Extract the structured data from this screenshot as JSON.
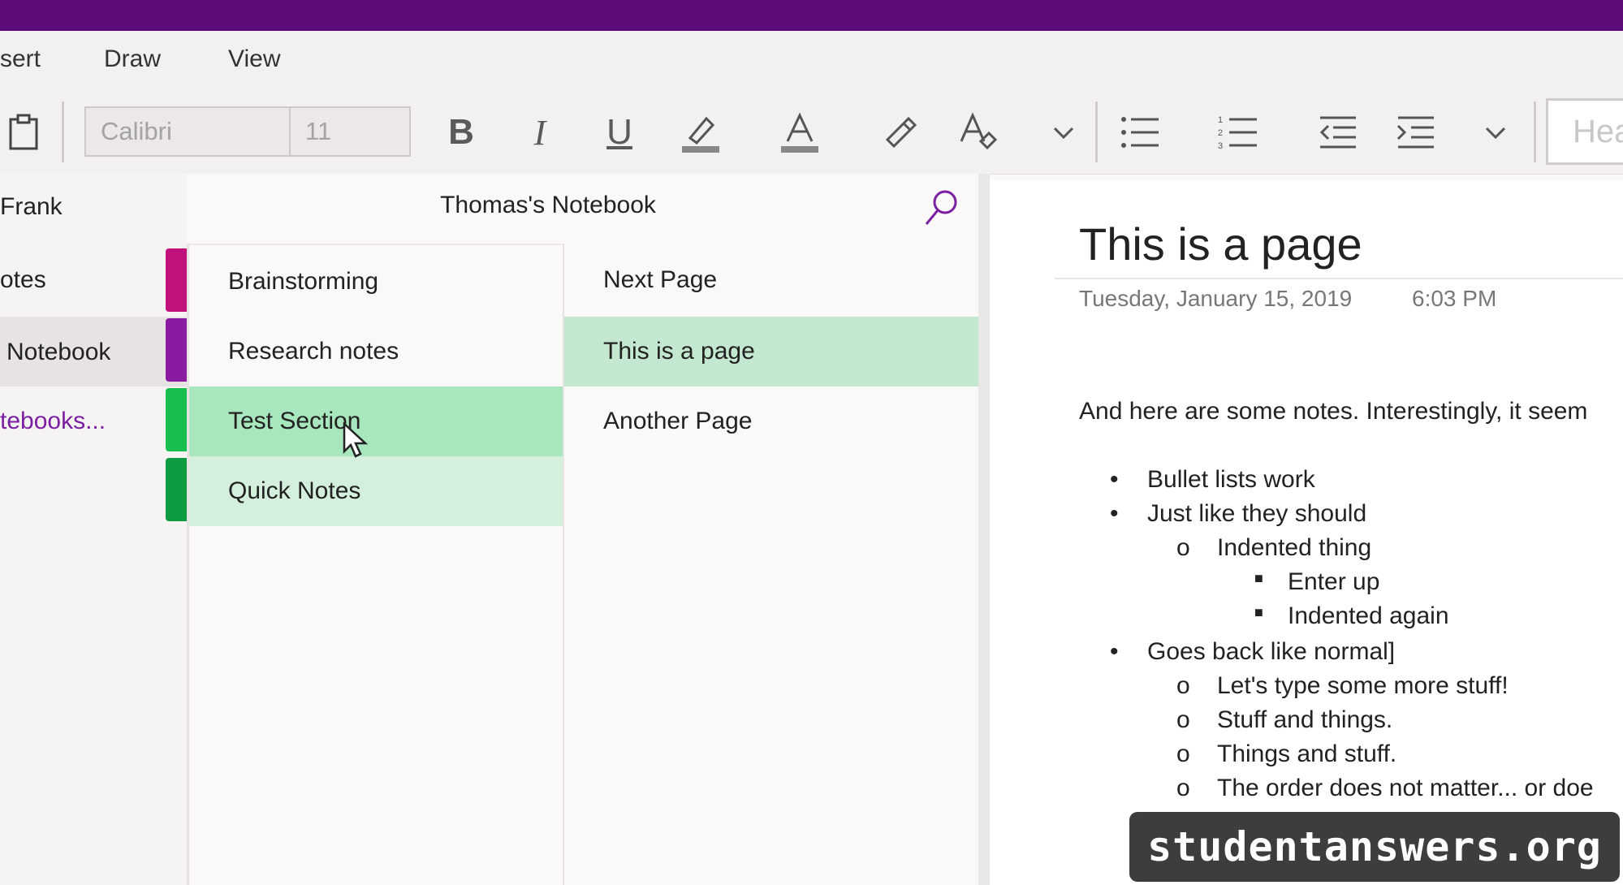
{
  "ribbon": {
    "tabs": [
      "sert",
      "Draw",
      "View"
    ],
    "font_name": "Calibri",
    "font_size": "11",
    "style_preview": "Hea"
  },
  "notebooks": {
    "items": [
      {
        "label": "Frank",
        "selected": false
      },
      {
        "label": "otes",
        "selected": false
      },
      {
        "label": "Notebook",
        "selected": true
      },
      {
        "label": "tebooks...",
        "link": true
      }
    ]
  },
  "notebook_header": {
    "title": "Thomas's Notebook"
  },
  "sections": [
    {
      "label": "Brainstorming",
      "color": "#c0127a"
    },
    {
      "label": "Research notes",
      "color": "#8a1aa0"
    },
    {
      "label": "Test Section",
      "color": "#17c04e",
      "state": "selected"
    },
    {
      "label": "Quick Notes",
      "color": "#0f9b3f",
      "state": "hover"
    }
  ],
  "pages": [
    {
      "label": "Next Page"
    },
    {
      "label": "This is a page",
      "state": "selected"
    },
    {
      "label": "Another Page"
    }
  ],
  "page": {
    "title": "This is a page",
    "date": "Tuesday, January 15, 2019",
    "time": "6:03 PM",
    "intro": "And here are some notes. Interestingly, it seem",
    "list": [
      {
        "level": 1,
        "text": "Bullet lists work"
      },
      {
        "level": 1,
        "text": "Just like they should"
      },
      {
        "level": 2,
        "text": "Indented thing"
      },
      {
        "level": 3,
        "text": "Enter up"
      },
      {
        "level": 3,
        "text": "Indented again"
      },
      {
        "level": 1,
        "text": "Goes back like normal]"
      },
      {
        "level": 2,
        "text": "Let's type some more stuff!"
      },
      {
        "level": 2,
        "text": "Stuff and things."
      },
      {
        "level": 2,
        "text": "Things and stuff."
      },
      {
        "level": 2,
        "text": "The order does not matter... or doe"
      }
    ]
  },
  "colors": {
    "title_bar": "#5c0b78",
    "accent": "#7a1fa2",
    "selected_green": "#a8e6bd",
    "hover_green": "#d4efdc",
    "page_selected": "#c4e7cf"
  },
  "watermark": "studentanswers.org"
}
